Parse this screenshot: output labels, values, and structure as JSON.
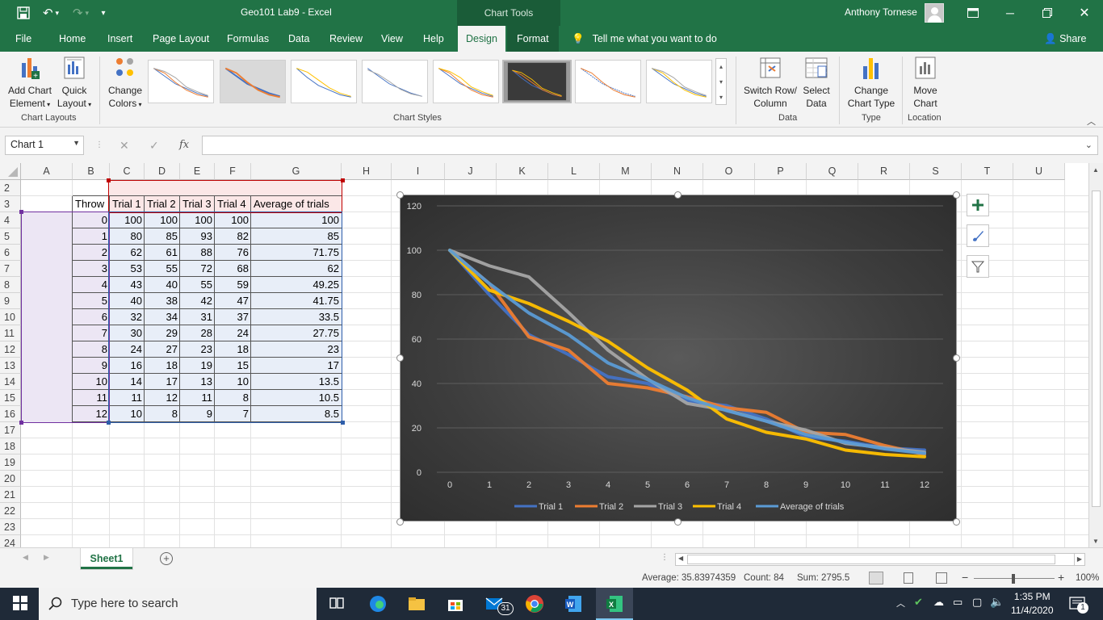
{
  "titlebar": {
    "doc_title": "Geo101 Lab9  -  Excel",
    "context_label": "Chart Tools",
    "user_name": "Anthony Tornese"
  },
  "tabs": [
    "File",
    "Home",
    "Insert",
    "Page Layout",
    "Formulas",
    "Data",
    "Review",
    "View",
    "Help",
    "Design",
    "Format"
  ],
  "tell_me": "Tell me what you want to do",
  "share": "Share",
  "ribbon": {
    "add_chart_element": [
      "Add Chart",
      "Element"
    ],
    "quick_layout": [
      "Quick",
      "Layout"
    ],
    "change_colors": [
      "Change",
      "Colors"
    ],
    "switch_row_column": [
      "Switch Row/",
      "Column"
    ],
    "select_data": [
      "Select",
      "Data"
    ],
    "change_chart_type": [
      "Change",
      "Chart Type"
    ],
    "move_chart": [
      "Move",
      "Chart"
    ],
    "groups": {
      "chart_layouts": "Chart Layouts",
      "chart_styles": "Chart Styles",
      "data": "Data",
      "type": "Type",
      "location": "Location"
    }
  },
  "name_box": "Chart 1",
  "fx": "fx",
  "columns": [
    "A",
    "B",
    "C",
    "D",
    "E",
    "F",
    "G",
    "H",
    "I",
    "J",
    "K",
    "L",
    "M",
    "N",
    "O",
    "P",
    "Q",
    "R",
    "S",
    "T",
    "U"
  ],
  "rows": [
    "2",
    "3",
    "4",
    "5",
    "6",
    "7",
    "8",
    "9",
    "10",
    "11",
    "12",
    "13",
    "14",
    "15",
    "16",
    "17",
    "18",
    "19",
    "20",
    "21",
    "22",
    "23",
    "24"
  ],
  "table": {
    "headers": [
      "Throw",
      "Trial 1",
      "Trial 2",
      "Trial 3",
      "Trial 4",
      "Average of trials"
    ],
    "rows": [
      [
        "0",
        "100",
        "100",
        "100",
        "100",
        "100"
      ],
      [
        "1",
        "80",
        "85",
        "93",
        "82",
        "85"
      ],
      [
        "2",
        "62",
        "61",
        "88",
        "76",
        "71.75"
      ],
      [
        "3",
        "53",
        "55",
        "72",
        "68",
        "62"
      ],
      [
        "4",
        "43",
        "40",
        "55",
        "59",
        "49.25"
      ],
      [
        "5",
        "40",
        "38",
        "42",
        "47",
        "41.75"
      ],
      [
        "6",
        "32",
        "34",
        "31",
        "37",
        "33.5"
      ],
      [
        "7",
        "30",
        "29",
        "28",
        "24",
        "27.75"
      ],
      [
        "8",
        "24",
        "27",
        "23",
        "18",
        "23"
      ],
      [
        "9",
        "16",
        "18",
        "19",
        "15",
        "17"
      ],
      [
        "10",
        "14",
        "17",
        "13",
        "10",
        "13.5"
      ],
      [
        "11",
        "11",
        "12",
        "11",
        "8",
        "10.5"
      ],
      [
        "12",
        "10",
        "8",
        "9",
        "7",
        "8.5"
      ]
    ]
  },
  "chart_data": {
    "type": "line",
    "x": [
      0,
      1,
      2,
      3,
      4,
      5,
      6,
      7,
      8,
      9,
      10,
      11,
      12
    ],
    "ylim": [
      0,
      120
    ],
    "yticks": [
      0,
      20,
      40,
      60,
      80,
      100,
      120
    ],
    "grid": true,
    "legend": "bottom",
    "series": [
      {
        "name": "Trial 1",
        "color": "#4472c4",
        "values": [
          100,
          80,
          62,
          53,
          43,
          40,
          32,
          30,
          24,
          16,
          14,
          11,
          10
        ]
      },
      {
        "name": "Trial 2",
        "color": "#ed7d31",
        "values": [
          100,
          85,
          61,
          55,
          40,
          38,
          34,
          29,
          27,
          18,
          17,
          12,
          8
        ]
      },
      {
        "name": "Trial 3",
        "color": "#a5a5a5",
        "values": [
          100,
          93,
          88,
          72,
          55,
          42,
          31,
          28,
          23,
          19,
          13,
          11,
          9
        ]
      },
      {
        "name": "Trial 4",
        "color": "#ffc000",
        "values": [
          100,
          82,
          76,
          68,
          59,
          47,
          37,
          24,
          18,
          15,
          10,
          8,
          7
        ]
      },
      {
        "name": "Average of trials",
        "color": "#5b9bd5",
        "values": [
          100,
          85,
          71.75,
          62,
          49.25,
          41.75,
          33.5,
          27.75,
          23,
          17,
          13.5,
          10.5,
          8.5
        ]
      }
    ]
  },
  "sheet_tab": "Sheet1",
  "status": {
    "average": "Average: 35.83974359",
    "count": "Count: 84",
    "sum": "Sum: 2795.5",
    "zoom": "100%"
  },
  "taskbar": {
    "search_placeholder": "Type here to search",
    "time": "1:35 PM",
    "date": "11/4/2020",
    "mail_badge": "31",
    "notification_count": "1"
  },
  "colors": {
    "excel_green": "#217346",
    "chart_bg": "#3d3d3d",
    "selection_purple": "#7030a0",
    "selection_red": "#c00000",
    "selection_blue": "#2e5eaa"
  }
}
